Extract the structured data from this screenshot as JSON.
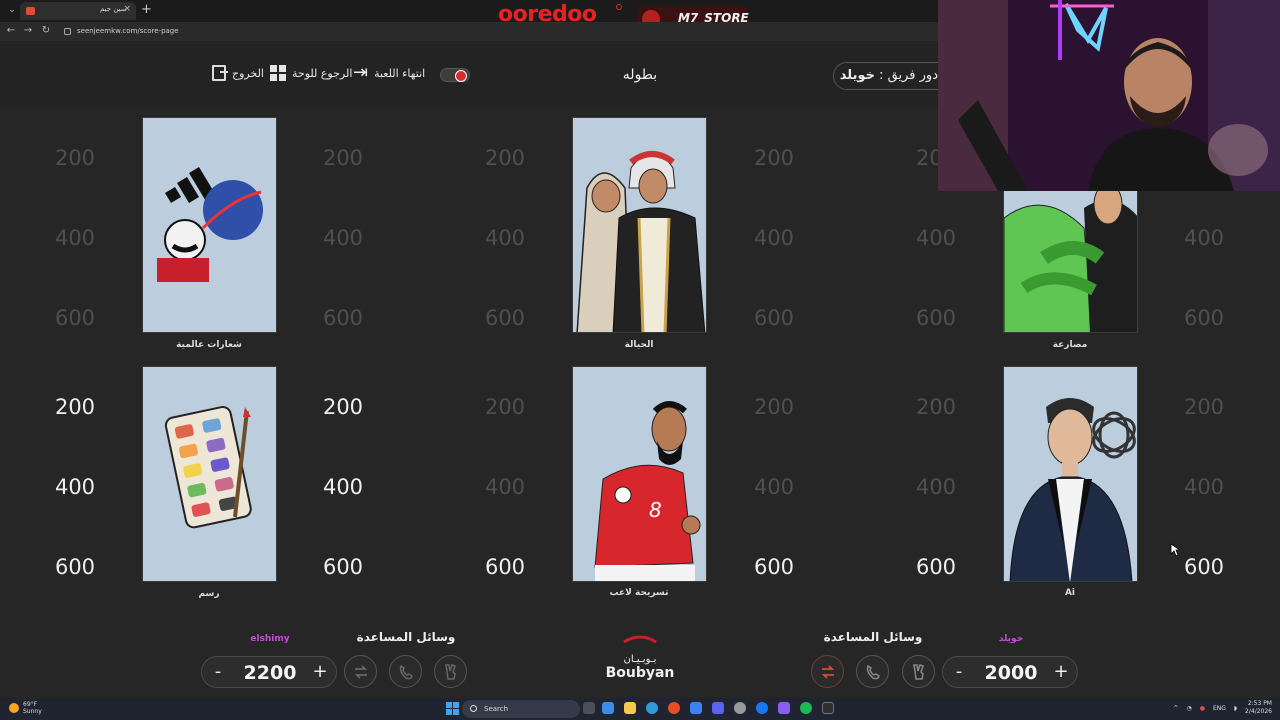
{
  "browser": {
    "tab_title": "سين جيم",
    "url": "seenjeemkw.com/score-page"
  },
  "brands": {
    "ooredoo": "ooredoo",
    "m7_store": "M7_STORE",
    "ooredoo_color": "#e42322"
  },
  "header": {
    "exit_label": "الخروج",
    "back_to_board_label": "الرجوع للوحة",
    "end_game_label": "انتهاء اللعبة",
    "game_title": "بطوله",
    "turn_prefix": "دور فريق :",
    "turn_team": "خويلد"
  },
  "board": {
    "point_values": [
      "200",
      "400",
      "600"
    ],
    "categories": [
      {
        "label": "شعارات عالمية",
        "icon": "logos-illustration"
      },
      {
        "label": "الحيالة",
        "icon": "traditional-men-illustration"
      },
      {
        "label": "مصارعة",
        "icon": "wrestling-illustration"
      },
      {
        "label": "رسم",
        "icon": "paint-palette-illustration"
      },
      {
        "label": "تسريحة لاعب",
        "icon": "football-player-illustration"
      },
      {
        "label": "Ai",
        "icon": "ai-person-illustration"
      }
    ]
  },
  "teams": {
    "left": {
      "name": "elshimy",
      "score": "2200",
      "helpers_title": "وسائل المساعدة",
      "minus": "-",
      "plus": "+"
    },
    "right": {
      "name": "خويلد",
      "score": "2000",
      "helpers_title": "وسائل المساعدة",
      "minus": "-",
      "plus": "+"
    }
  },
  "sponsor": {
    "ar": "بـوبـيـان",
    "en": "Boubyan"
  },
  "taskbar": {
    "temp": "69°F",
    "weather": "Sunny",
    "search": "Search",
    "lang": "ENG",
    "time": "2:53 PM",
    "date": "2/4/2026"
  },
  "colors": {
    "background": "#262626",
    "header": "#232323",
    "team_name": "#c44fd6",
    "card_bg": "#bccddd"
  }
}
